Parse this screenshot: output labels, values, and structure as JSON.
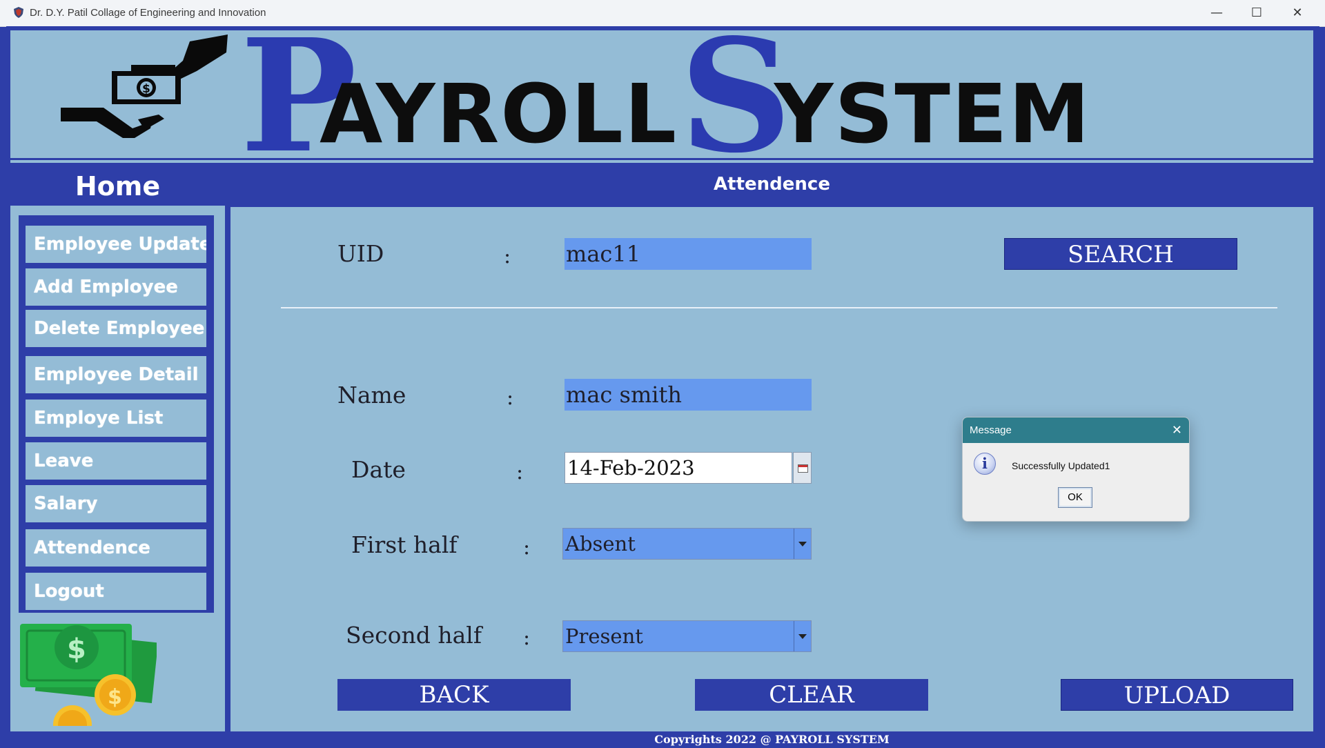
{
  "window": {
    "title": "Dr. D.Y. Patil Collage of Engineering and Innovation",
    "controls": {
      "minimize": "—",
      "maximize": "☐",
      "close": "✕"
    }
  },
  "banner": {
    "title_p": "P",
    "title_ayroll": "AYROLL",
    "title_s": "S",
    "title_ystem": "YSTEM"
  },
  "sidebar": {
    "header": "Home",
    "items": [
      {
        "label": "Employee Update"
      },
      {
        "label": "Add Employee"
      },
      {
        "label": "Delete Employee"
      },
      {
        "label": "Employee Detail"
      },
      {
        "label": "Employe List"
      },
      {
        "label": "Leave"
      },
      {
        "label": "Salary"
      },
      {
        "label": "Attendence"
      },
      {
        "label": "Logout"
      }
    ]
  },
  "main": {
    "header": "Attendence",
    "uid_label": "UID",
    "uid_value": "mac11",
    "search_label": "SEARCH",
    "name_label": "Name",
    "name_value": "mac smith",
    "date_label": "Date",
    "date_value": "14-Feb-2023",
    "first_half_label": "First half",
    "first_half_value": "Absent",
    "second_half_label": "Second half",
    "second_half_value": "Present",
    "colon": ":",
    "back_label": "BACK",
    "clear_label": "CLEAR",
    "upload_label": "UPLOAD"
  },
  "footer": "Copyrights 2022 @ PAYROLL SYSTEM",
  "dialog": {
    "title": "Message",
    "close": "✕",
    "icon_glyph": "i",
    "message": "Successfully Updated1",
    "ok_label": "OK"
  },
  "colors": {
    "brand_blue": "#2e3ea8",
    "panel_bg": "#94bcd6",
    "field_bg": "#6699ee",
    "dialog_bar": "#2e7d8c"
  }
}
